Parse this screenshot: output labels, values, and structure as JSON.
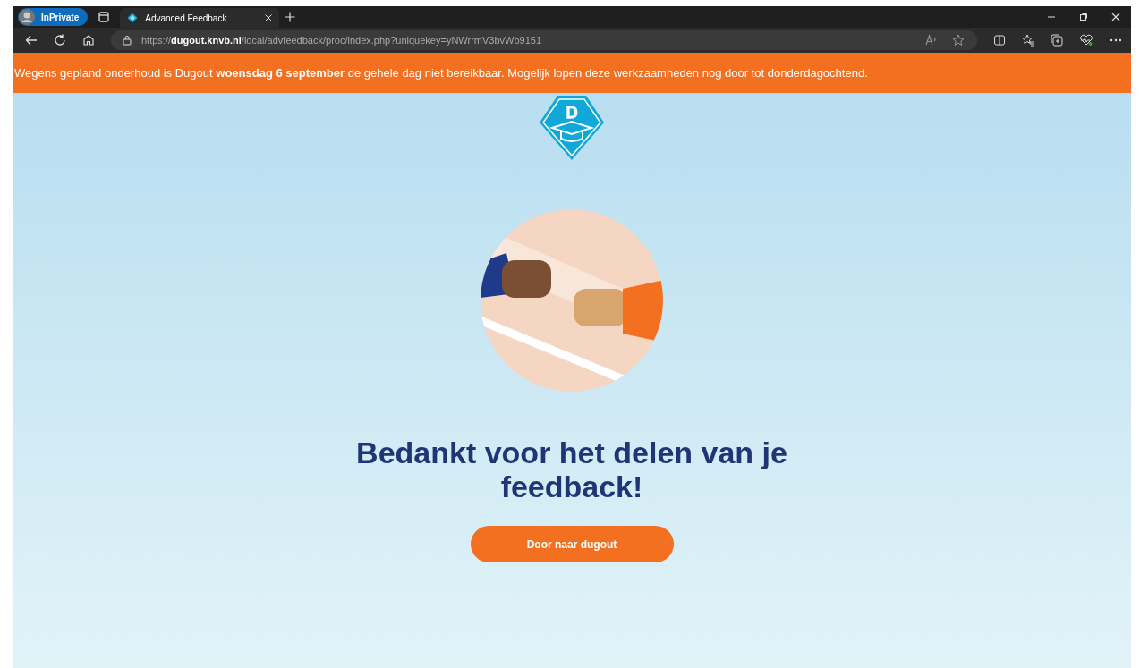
{
  "browser": {
    "profile": "InPrivate",
    "tabs": [
      {
        "title": "Advanced Feedback",
        "selected": true
      }
    ],
    "url": "https://**dugout.knvb.nl**/local/advfeedback/proc/index.php?uniquekey=yNWrrmV3bvWb9151"
  },
  "banner": {
    "text": "Wegens gepland onderhoud is Dugout **woensdag 6 september** de gehele dag niet bereikbaar. Mogelijk lopen deze werkzaamheden nog door tot donderdagochtend."
  },
  "logo": {
    "letter": "D"
  },
  "heading": "Bedankt voor het delen van je feedback!",
  "button": "Door naar dugout"
}
